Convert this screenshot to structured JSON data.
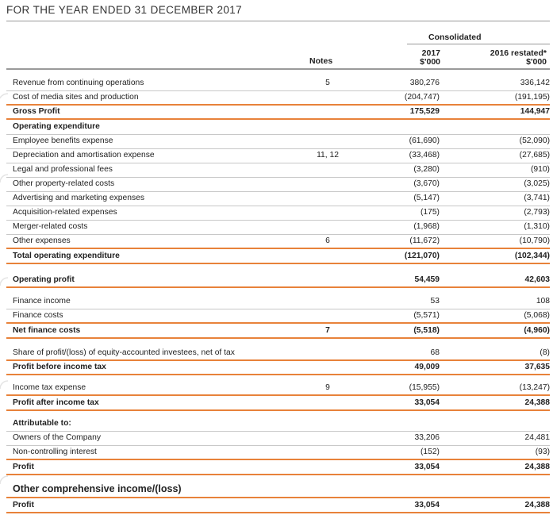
{
  "header": {
    "title": "FOR THE YEAR ENDED 31 DECEMBER 2017"
  },
  "columns": {
    "group": "Consolidated",
    "notes": "Notes",
    "y2017": "2017",
    "y2017_unit": "$'000",
    "y2016": "2016 restated*",
    "y2016_unit": "$'000"
  },
  "rows": [
    {
      "label": "Revenue from continuing operations",
      "notes": "5",
      "v2017": "380,276",
      "v2016": "336,142"
    },
    {
      "label": "Cost of media sites and production",
      "notes": "",
      "v2017": "(204,747)",
      "v2016": "(191,195)"
    },
    {
      "label": "Gross Profit",
      "notes": "",
      "v2017": "175,529",
      "v2016": "144,947"
    },
    {
      "label": "Operating expenditure",
      "notes": "",
      "v2017": "",
      "v2016": ""
    },
    {
      "label": "Employee benefits expense",
      "notes": "",
      "v2017": "(61,690)",
      "v2016": "(52,090)"
    },
    {
      "label": "Depreciation and amortisation expense",
      "notes": "11, 12",
      "v2017": "(33,468)",
      "v2016": "(27,685)"
    },
    {
      "label": "Legal and professional fees",
      "notes": "",
      "v2017": "(3,280)",
      "v2016": "(910)"
    },
    {
      "label": "Other property-related costs",
      "notes": "",
      "v2017": "(3,670)",
      "v2016": "(3,025)"
    },
    {
      "label": "Advertising and marketing expenses",
      "notes": "",
      "v2017": "(5,147)",
      "v2016": "(3,741)"
    },
    {
      "label": "Acquisition-related expenses",
      "notes": "",
      "v2017": "(175)",
      "v2016": "(2,793)"
    },
    {
      "label": "Merger-related costs",
      "notes": "",
      "v2017": "(1,968)",
      "v2016": "(1,310)"
    },
    {
      "label": "Other expenses",
      "notes": "6",
      "v2017": "(11,672)",
      "v2016": "(10,790)"
    },
    {
      "label": "Total operating expenditure",
      "notes": "",
      "v2017": "(121,070)",
      "v2016": "(102,344)"
    },
    {
      "label": "Operating profit",
      "notes": "",
      "v2017": "54,459",
      "v2016": "42,603"
    },
    {
      "label": "Finance income",
      "notes": "",
      "v2017": "53",
      "v2016": "108"
    },
    {
      "label": "Finance costs",
      "notes": "",
      "v2017": "(5,571)",
      "v2016": "(5,068)"
    },
    {
      "label": "Net finance costs",
      "notes": "7",
      "v2017": "(5,518)",
      "v2016": "(4,960)"
    },
    {
      "label": "Share of profit/(loss) of equity-accounted investees, net of tax",
      "notes": "",
      "v2017": "68",
      "v2016": "(8)"
    },
    {
      "label": "Profit before income tax",
      "notes": "",
      "v2017": "49,009",
      "v2016": "37,635"
    },
    {
      "label": "Income tax expense",
      "notes": "9",
      "v2017": "(15,955)",
      "v2016": "(13,247)"
    },
    {
      "label": "Profit after income tax",
      "notes": "",
      "v2017": "33,054",
      "v2016": "24,388"
    },
    {
      "label": "Attributable to:",
      "notes": "",
      "v2017": "",
      "v2016": ""
    },
    {
      "label": "Owners of the Company",
      "notes": "",
      "v2017": "33,206",
      "v2016": "24,481"
    },
    {
      "label": "Non-controlling interest",
      "notes": "",
      "v2017": "(152)",
      "v2016": "(93)"
    },
    {
      "label": "Profit",
      "notes": "",
      "v2017": "33,054",
      "v2016": "24,388"
    },
    {
      "label": "Other comprehensive income/(loss)",
      "notes": "",
      "v2017": "",
      "v2016": ""
    },
    {
      "label": "Profit",
      "notes": "",
      "v2017": "33,054",
      "v2016": "24,388"
    }
  ]
}
